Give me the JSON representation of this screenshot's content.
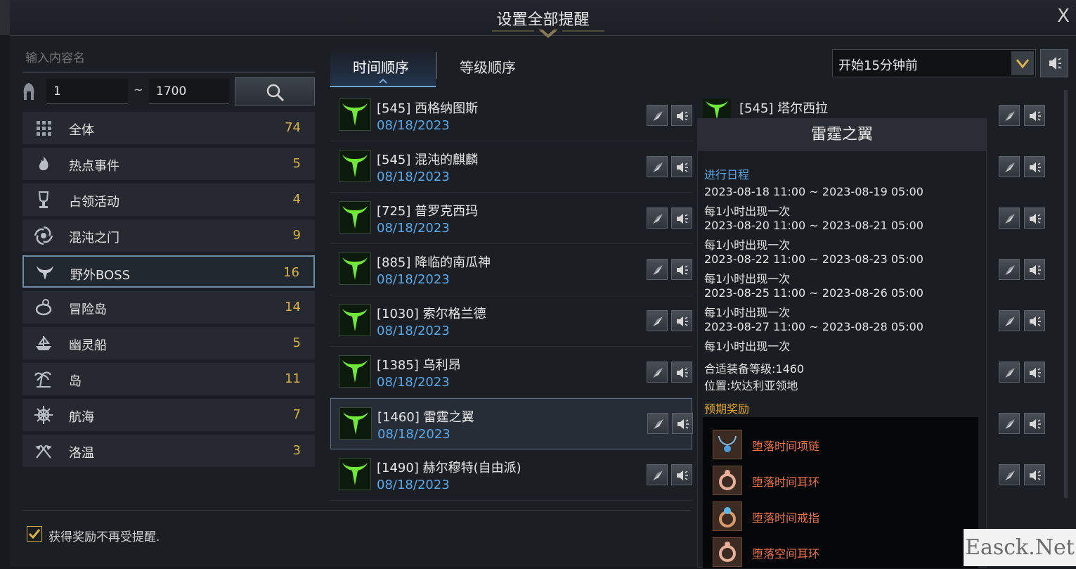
{
  "window": {
    "title": "设置全部提醒",
    "close_glyph": "X"
  },
  "search": {
    "placeholder": "输入内容名"
  },
  "range": {
    "min": "1",
    "sep": "~",
    "max": "1700"
  },
  "categories": [
    {
      "label": "全体",
      "count": "74"
    },
    {
      "label": "热点事件",
      "count": "5"
    },
    {
      "label": "占领活动",
      "count": "4"
    },
    {
      "label": "混沌之门",
      "count": "9"
    },
    {
      "label": "野外BOSS",
      "count": "16"
    },
    {
      "label": "冒险岛",
      "count": "14"
    },
    {
      "label": "幽灵船",
      "count": "5"
    },
    {
      "label": "岛",
      "count": "11"
    },
    {
      "label": "航海",
      "count": "7"
    },
    {
      "label": "洛温",
      "count": "3"
    }
  ],
  "tabs": {
    "time_order": "时间顺序",
    "level_order": "等级顺序"
  },
  "alarm_select": {
    "value": "开始15分钟前"
  },
  "events": [
    {
      "name": "[545] 西格纳图斯",
      "date": "08/18/2023"
    },
    {
      "name": "[545] 混沌的麒麟",
      "date": "08/18/2023"
    },
    {
      "name": "[725] 普罗克西玛",
      "date": "08/18/2023"
    },
    {
      "name": "[885] 降临的南瓜神",
      "date": "08/18/2023"
    },
    {
      "name": "[1030] 索尔格兰德",
      "date": "08/18/2023"
    },
    {
      "name": "[1385] 乌利昂",
      "date": "08/18/2023"
    },
    {
      "name": "[1460] 雷霆之翼",
      "date": "08/18/2023"
    },
    {
      "name": "[1490] 赫尔穆特(自由派)",
      "date": "08/18/2023"
    }
  ],
  "right_events": [
    {
      "name": "[545] 塔尔西拉"
    }
  ],
  "tooltip": {
    "title": "雷霆之翼",
    "schedule_label": "进行日程",
    "schedule": [
      {
        "range": "2023-08-18 11:00 ~ 2023-08-19 05:00",
        "freq": "每1小时出现一次"
      },
      {
        "range": "2023-08-20 11:00 ~ 2023-08-21 05:00",
        "freq": "每1小时出现一次"
      },
      {
        "range": "2023-08-22 11:00 ~ 2023-08-23 05:00",
        "freq": "每1小时出现一次"
      },
      {
        "range": "2023-08-25 11:00 ~ 2023-08-26 05:00",
        "freq": "每1小时出现一次"
      },
      {
        "range": "2023-08-27 11:00 ~ 2023-08-28 05:00",
        "freq": "每1小时出现一次"
      }
    ],
    "level": "合适装备等级:1460",
    "location": "位置:坎达利亚领地",
    "rewards_label": "预期奖励",
    "rewards": [
      "堕落时间项链",
      "堕落时间耳环",
      "堕落时间戒指",
      "堕落空间耳环"
    ]
  },
  "footer": {
    "checkbox_label": "获得奖励不再受提醒."
  },
  "watermark": "Easck.Net",
  "colors": {
    "accent_blue": "#5aa8e8",
    "count_gold": "#d9b24a",
    "reward_orange": "#f0724a",
    "section_gold": "#e3a92a"
  }
}
